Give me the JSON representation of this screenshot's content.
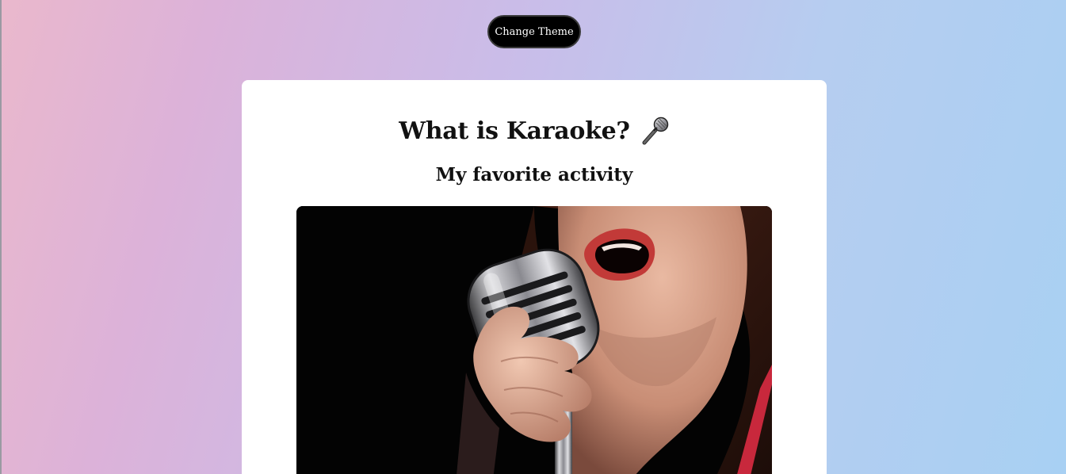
{
  "header": {
    "theme_button_label": "Change Theme"
  },
  "card": {
    "title": "What is Karaoke?",
    "title_icon": "microphone-icon",
    "subtitle": "My favorite activity",
    "photo": {
      "subject": "singer-with-vintage-microphone",
      "alt": ""
    }
  },
  "colors": {
    "button_bg": "#000000",
    "button_text": "#ffffff",
    "card_bg": "#ffffff",
    "gradient_left": "#eab8cc",
    "gradient_right": "#a8d0f3"
  }
}
